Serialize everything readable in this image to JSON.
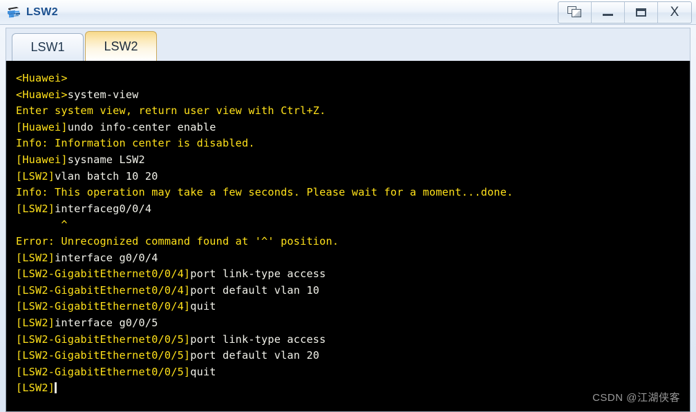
{
  "window": {
    "title": "LSW2",
    "icon": "switch-icon",
    "controls": [
      {
        "name": "cascade-windows-button",
        "label": "Cascade"
      },
      {
        "name": "minimize-button",
        "label": "Minimize"
      },
      {
        "name": "maximize-button",
        "label": "Maximize"
      },
      {
        "name": "close-button",
        "label": "X"
      }
    ]
  },
  "tabs": [
    {
      "label": "LSW1",
      "active": false
    },
    {
      "label": "LSW2",
      "active": true
    }
  ],
  "terminal": {
    "background": "#000000",
    "prompt_color": "#ffe11a",
    "command_color": "#f2f2ea",
    "lines": [
      {
        "segments": [
          {
            "text": "",
            "style": "out"
          }
        ]
      },
      {
        "segments": [
          {
            "text": "<Huawei>",
            "style": "prompt"
          }
        ]
      },
      {
        "segments": [
          {
            "text": "<Huawei>",
            "style": "prompt"
          },
          {
            "text": "system-view",
            "style": "cmd"
          }
        ]
      },
      {
        "segments": [
          {
            "text": "Enter system view, return user view with Ctrl+Z.",
            "style": "out"
          }
        ]
      },
      {
        "segments": [
          {
            "text": "[Huawei]",
            "style": "prompt"
          },
          {
            "text": "undo info-center enable",
            "style": "cmd"
          }
        ]
      },
      {
        "segments": [
          {
            "text": "Info: Information center is disabled.",
            "style": "out"
          }
        ]
      },
      {
        "segments": [
          {
            "text": "[Huawei]",
            "style": "prompt"
          },
          {
            "text": "sysname LSW2",
            "style": "cmd"
          }
        ]
      },
      {
        "segments": [
          {
            "text": "[LSW2]",
            "style": "prompt"
          },
          {
            "text": "vlan batch 10 20",
            "style": "cmd"
          }
        ]
      },
      {
        "segments": [
          {
            "text": "Info: This operation may take a few seconds. Please wait for a moment...done.",
            "style": "out"
          }
        ]
      },
      {
        "segments": [
          {
            "text": "[LSW2]",
            "style": "prompt"
          },
          {
            "text": "interfaceg0/0/4",
            "style": "cmd"
          }
        ]
      },
      {
        "segments": [
          {
            "text": "       ^",
            "style": "caret"
          }
        ]
      },
      {
        "segments": [
          {
            "text": "",
            "style": "out"
          }
        ]
      },
      {
        "segments": [
          {
            "text": "Error: Unrecognized command found at '^' position.",
            "style": "out"
          }
        ]
      },
      {
        "segments": [
          {
            "text": "[LSW2]",
            "style": "prompt"
          },
          {
            "text": "interface g0/0/4",
            "style": "cmd"
          }
        ]
      },
      {
        "segments": [
          {
            "text": "[LSW2-GigabitEthernet0/0/4]",
            "style": "prompt"
          },
          {
            "text": "port link-type access",
            "style": "cmd"
          }
        ]
      },
      {
        "segments": [
          {
            "text": "[LSW2-GigabitEthernet0/0/4]",
            "style": "prompt"
          },
          {
            "text": "port default vlan 10",
            "style": "cmd"
          }
        ]
      },
      {
        "segments": [
          {
            "text": "[LSW2-GigabitEthernet0/0/4]",
            "style": "prompt"
          },
          {
            "text": "quit",
            "style": "cmd"
          }
        ]
      },
      {
        "segments": [
          {
            "text": "[LSW2]",
            "style": "prompt"
          },
          {
            "text": "interface g0/0/5",
            "style": "cmd"
          }
        ]
      },
      {
        "segments": [
          {
            "text": "[LSW2-GigabitEthernet0/0/5]",
            "style": "prompt"
          },
          {
            "text": "port link-type access",
            "style": "cmd"
          }
        ]
      },
      {
        "segments": [
          {
            "text": "[LSW2-GigabitEthernet0/0/5]",
            "style": "prompt"
          },
          {
            "text": "port default vlan 20",
            "style": "cmd"
          }
        ]
      },
      {
        "segments": [
          {
            "text": "[LSW2-GigabitEthernet0/0/5]",
            "style": "prompt"
          },
          {
            "text": "quit",
            "style": "cmd"
          }
        ]
      },
      {
        "segments": [
          {
            "text": "[LSW2]",
            "style": "prompt"
          },
          {
            "text": "",
            "style": "cmd",
            "cursor": true
          }
        ]
      }
    ]
  },
  "watermark": {
    "text": "CSDN @江湖侠客",
    "color": "#9a9a9a"
  }
}
